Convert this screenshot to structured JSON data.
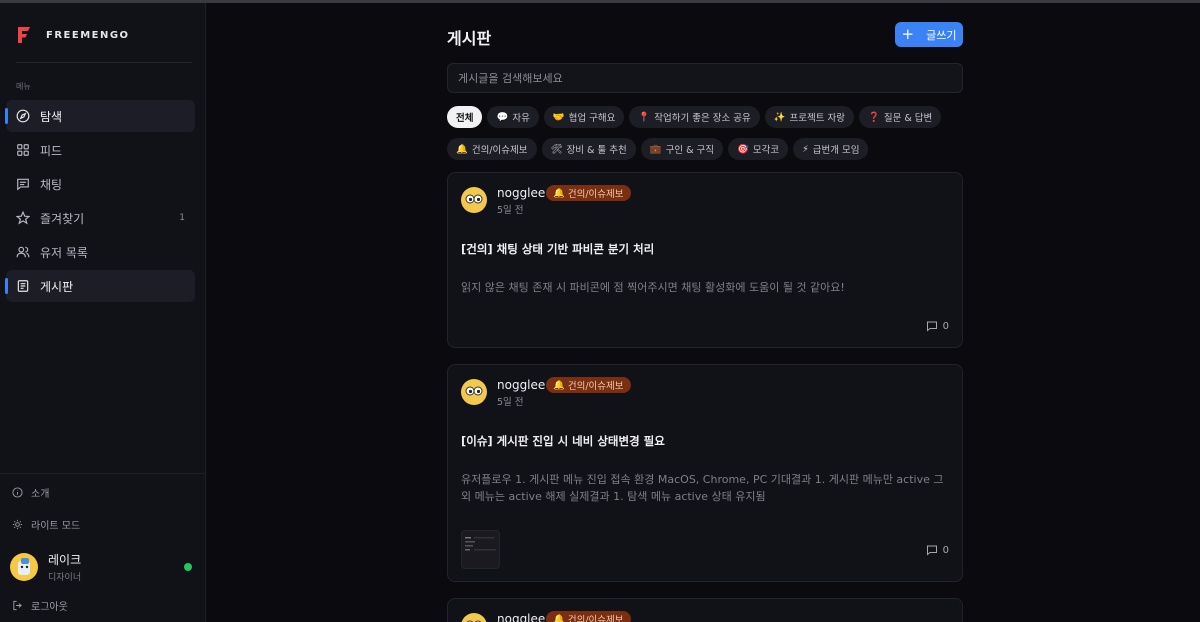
{
  "brand": {
    "name": "FREEMENGO",
    "accent": "#3b82f6",
    "logo_color": "#ef4444"
  },
  "sidebar": {
    "menu_heading": "메뉴",
    "items": [
      {
        "label": "탐색",
        "icon": "compass-icon",
        "active": true,
        "count": ""
      },
      {
        "label": "피드",
        "icon": "grid-icon",
        "active": false,
        "count": ""
      },
      {
        "label": "채팅",
        "icon": "chat-icon",
        "active": false,
        "count": ""
      },
      {
        "label": "즐겨찾기",
        "icon": "star-icon",
        "active": false,
        "count": "1"
      },
      {
        "label": "유저 목록",
        "icon": "users-icon",
        "active": false,
        "count": ""
      },
      {
        "label": "게시판",
        "icon": "document-icon",
        "active": true,
        "count": ""
      }
    ],
    "about_label": "소개",
    "theme_label": "라이트 모드",
    "user": {
      "name": "레이크",
      "role": "디자이너",
      "status_color": "#22c55e"
    },
    "logout_label": "로그아웃"
  },
  "board": {
    "title": "게시판",
    "write_label": "글쓰기",
    "search_placeholder": "게시글을 검색해보세요",
    "categories": [
      {
        "label": "전체",
        "emoji": ""
      },
      {
        "label": "자유",
        "emoji": "💬"
      },
      {
        "label": "협업 구해요",
        "emoji": "🤝"
      },
      {
        "label": "작업하기 좋은 장소 공유",
        "emoji": "📍"
      },
      {
        "label": "프로젝트 자랑",
        "emoji": "✨"
      },
      {
        "label": "질문 & 답변",
        "emoji": "❓"
      },
      {
        "label": "건의/이슈제보",
        "emoji": "🔔"
      },
      {
        "label": "장비 & 툴 추천",
        "emoji": "🛠"
      },
      {
        "label": "구인 & 구직",
        "emoji": "💼"
      },
      {
        "label": "모각코",
        "emoji": "🎯"
      },
      {
        "label": "급번개 모임",
        "emoji": "⚡"
      }
    ],
    "posts": [
      {
        "author": "nogglee",
        "badge": "건의/이슈제보",
        "badge_emoji": "🔔",
        "time": "5일 전",
        "title": "[건의] 채팅 상태 기반 파비콘 분기 처리",
        "body": "읽지 않은 채팅 존재 시 파비콘에 점 찍어주시면 채팅 활성화에 도움이 될 것 같아요!",
        "comments": "0"
      },
      {
        "author": "nogglee",
        "badge": "건의/이슈제보",
        "badge_emoji": "🔔",
        "time": "5일 전",
        "title": "[이슈] 게시판 진입 시 네비 상태변경 필요",
        "body": "유저플로우 1. 게시판 메뉴 진입 접속 환경 MacOS, Chrome, PC 기대결과 1. 게시판 메뉴만 active 그 외 메뉴는 active 해제 실제결과 1. 탐색 메뉴 active 상태 유지됨",
        "comments": "0"
      },
      {
        "author": "nogglee",
        "badge": "건의/이슈제보",
        "badge_emoji": "🔔"
      }
    ]
  }
}
